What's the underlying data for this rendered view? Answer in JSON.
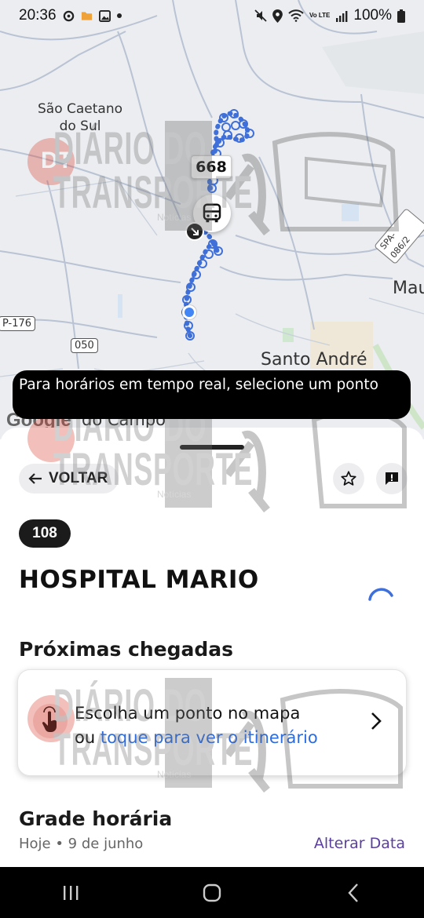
{
  "status_bar": {
    "time": "20:36",
    "battery": "100%",
    "signal_label": "Vo LTE"
  },
  "map": {
    "places": {
      "sao_caetano": "São Caetano\ndo Sul",
      "santo_andre": "Santo André",
      "maua": "Mau",
      "partial_bottom": "do Campo"
    },
    "shields": {
      "sp176": "P-176",
      "r050": "050",
      "spa": "SPA-086/2"
    },
    "route_number": "668",
    "google": "Google"
  },
  "toast": {
    "text": "Para horários em tempo real, selecione um ponto"
  },
  "sheet": {
    "back_label": "VOLTAR",
    "line_code": "108",
    "line_name": "HOSPITAL MARIO",
    "next_arrivals_title": "Próximas chegadas",
    "card": {
      "line1": "Escolha um ponto no mapa",
      "line2_prefix": "ou ",
      "line2_link": "toque para ver o itinerário"
    },
    "schedule_title": "Grade horária",
    "date": "Hoje • 9 de junho",
    "change_date": "Alterar Data"
  },
  "watermark": {
    "brand_line1": "DIÁRIO DO",
    "brand_line2": "TRANSPORTE",
    "brand_sub": "Notícias",
    "logo_letters": "DT"
  },
  "colors": {
    "accent_purple": "#5b3fa0",
    "link_blue": "#2d6cdf",
    "route_blue": "#3f6fd8",
    "user_dot": "#4285f4"
  }
}
